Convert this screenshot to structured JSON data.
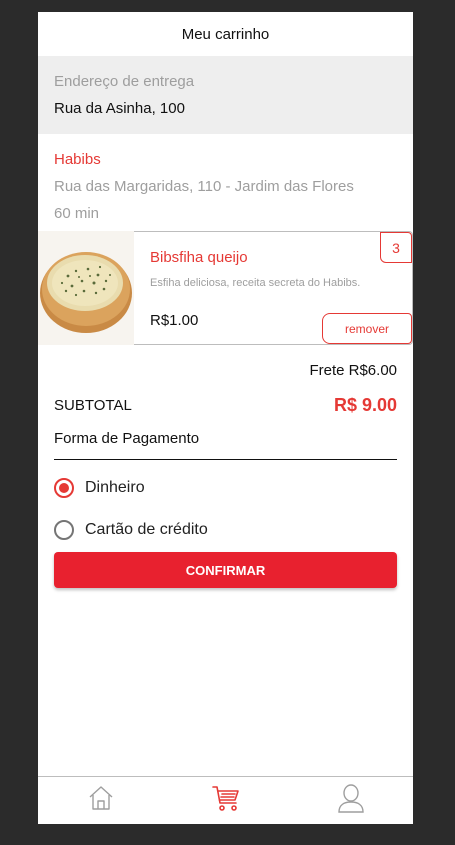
{
  "header": {
    "title": "Meu carrinho"
  },
  "delivery": {
    "label": "Endereço de entrega",
    "address": "Rua da Asinha, 100"
  },
  "restaurant": {
    "name": "Habibs",
    "address": "Rua das Margaridas, 110 - Jardim das Flores",
    "time": "60 min"
  },
  "cart_item": {
    "name": "Bibsfiha queijo",
    "description": "Esfiha deliciosa, receita secreta do Habibs.",
    "price": "R$1.00",
    "quantity": "3",
    "remove_label": "remover"
  },
  "summary": {
    "frete": "Frete R$6.00",
    "subtotal_label": "SUBTOTAL",
    "subtotal_value": "R$ 9.00"
  },
  "payment": {
    "title": "Forma de Pagamento",
    "options": [
      {
        "label": "Dinheiro",
        "selected": true
      },
      {
        "label": "Cartão de crédito",
        "selected": false
      }
    ]
  },
  "confirm_label": "CONFIRMAR",
  "nav": [
    {
      "icon": "home-icon",
      "active": false
    },
    {
      "icon": "cart-icon",
      "active": true
    },
    {
      "icon": "user-icon",
      "active": false
    }
  ],
  "colors": {
    "accent": "#e53935",
    "button": "#e8212f",
    "muted": "#9e9e9e",
    "background": "#2b2b2b"
  }
}
